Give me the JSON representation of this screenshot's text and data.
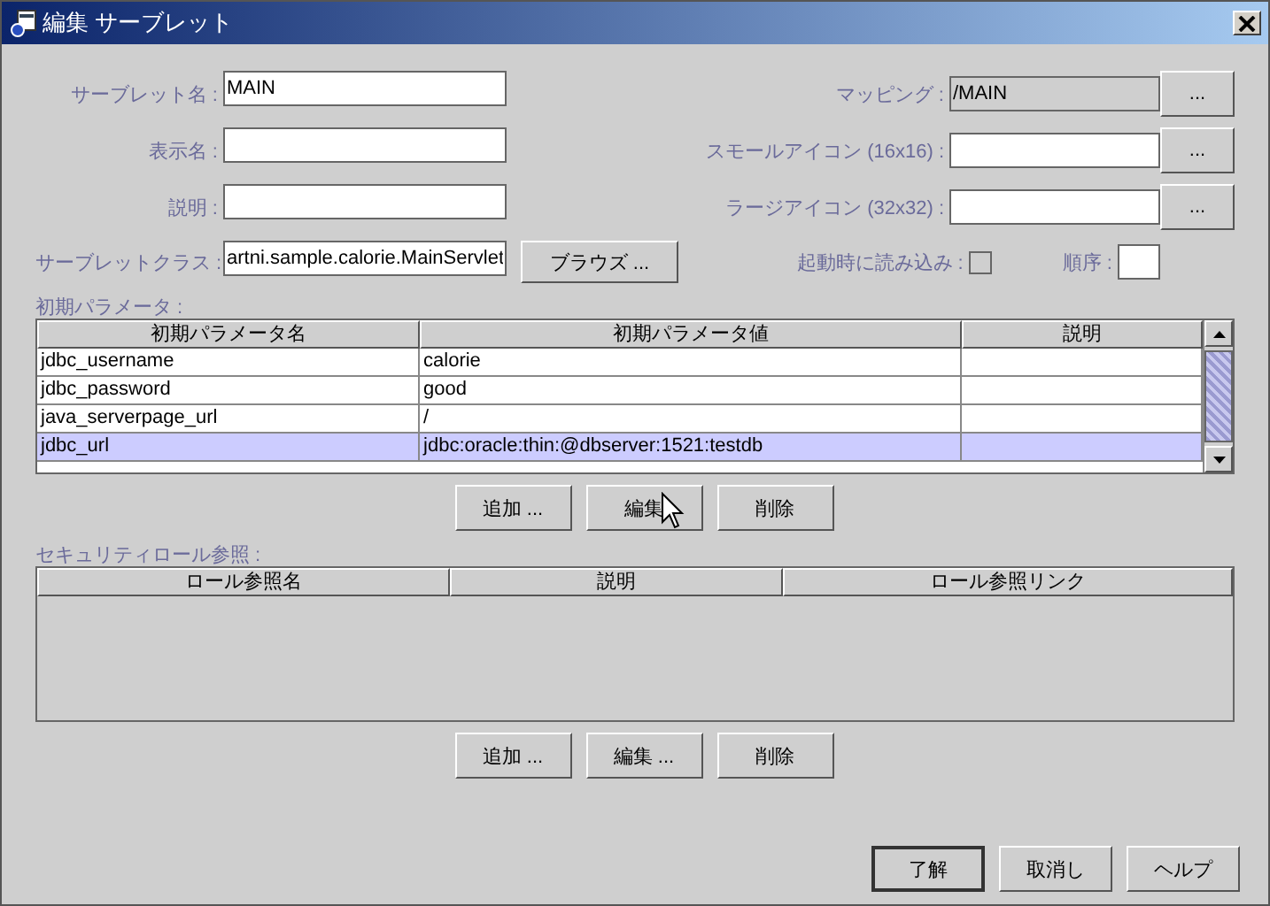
{
  "window": {
    "title": "編集 サーブレット"
  },
  "form": {
    "left": [
      {
        "label": "サーブレット名 :",
        "value": "MAIN"
      },
      {
        "label": "表示名 :"
      },
      {
        "label": "説明 :"
      }
    ],
    "right": [
      {
        "label": "マッピング :",
        "value": "/MAIN",
        "disabled": true,
        "button": "..."
      },
      {
        "label": "スモールアイコン (16x16) :",
        "disabled": false,
        "button": "..."
      },
      {
        "label": "ラージアイコン (32x32) :",
        "disabled": false,
        "button": "..."
      }
    ],
    "servlet_class": {
      "label": "サーブレットクラス :",
      "value": "artni.sample.calorie.MainServlet",
      "button": "ブラウズ ..."
    },
    "load_on_startup": {
      "label": "起動時に読み込み :",
      "checked": false
    },
    "order": {
      "label": "順序 :"
    }
  },
  "init_params": {
    "label": "初期パラメータ :",
    "columns": [
      "初期パラメータ名",
      "初期パラメータ値",
      "説明"
    ],
    "rows": [
      {
        "cells": [
          "jdbc_username",
          "calorie"
        ],
        "selected": false
      },
      {
        "cells": [
          "jdbc_password",
          "good"
        ],
        "selected": false
      },
      {
        "cells": [
          "java_serverpage_url",
          "/"
        ],
        "selected": false
      },
      {
        "cells": [
          "jdbc_url",
          "jdbc:oracle:thin:@dbserver:1521:testdb"
        ],
        "selected": true
      }
    ],
    "buttons": [
      "追加 ...",
      "編集",
      "削除"
    ]
  },
  "security_roles": {
    "label": "セキュリティロール参照 :",
    "columns": [
      "ロール参照名",
      "説明",
      "ロール参照リンク"
    ],
    "buttons": [
      "追加 ...",
      "編集 ...",
      "削除"
    ]
  },
  "dialog_buttons": [
    {
      "label": "了解",
      "default": true
    },
    {
      "label": "取消し",
      "default": false
    },
    {
      "label": "ヘルプ",
      "default": false
    }
  ]
}
